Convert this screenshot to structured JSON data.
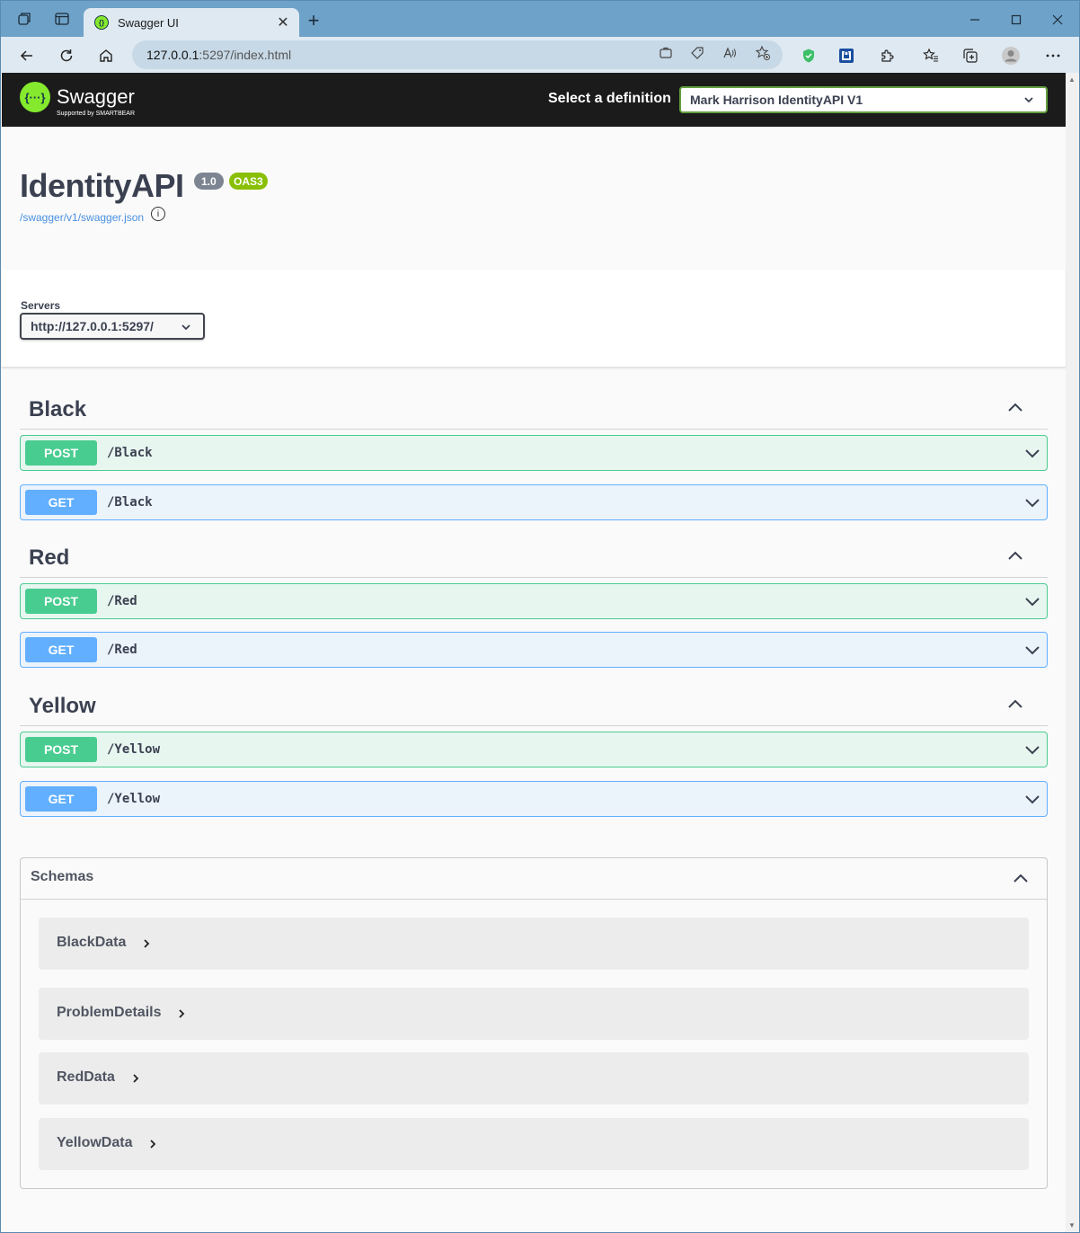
{
  "browser": {
    "tab_title": "Swagger UI",
    "tab_close": "✕",
    "new_tab": "+",
    "url_host": "127.0.0.1",
    "url_rest": ":5297/index.html",
    "icons": [
      "workspaces-icon",
      "tab-actions-icon",
      "back-icon",
      "refresh-icon",
      "home-icon",
      "info-icon",
      "app-available-icon",
      "tag-icon",
      "read-aloud-icon",
      "favorite-add-icon",
      "shield-icon",
      "extension-badge-icon",
      "extensions-icon",
      "favorites-icon",
      "collections-icon",
      "profile-icon",
      "more-icon"
    ]
  },
  "swagger": {
    "logo_text": "Swagger",
    "logo_sub": "Supported by SMARTBEAR",
    "logo_glyph": "{···}",
    "select_label": "Select a definition",
    "selected_definition": "Mark Harrison IdentityAPI V1"
  },
  "info": {
    "title": "IdentityAPI",
    "version": "1.0",
    "oas": "OAS3",
    "spec_link": "/swagger/v1/swagger.json"
  },
  "servers": {
    "label": "Servers",
    "selected": "http://127.0.0.1:5297/"
  },
  "tags": [
    {
      "name": "Black",
      "ops": [
        {
          "method": "POST",
          "path": "/Black"
        },
        {
          "method": "GET",
          "path": "/Black"
        }
      ]
    },
    {
      "name": "Red",
      "ops": [
        {
          "method": "POST",
          "path": "/Red"
        },
        {
          "method": "GET",
          "path": "/Red"
        }
      ]
    },
    {
      "name": "Yellow",
      "ops": [
        {
          "method": "POST",
          "path": "/Yellow"
        },
        {
          "method": "GET",
          "path": "/Yellow"
        }
      ]
    }
  ],
  "schemas": {
    "title": "Schemas",
    "models": [
      "BlackData",
      "ProblemDetails",
      "RedData",
      "YellowData"
    ]
  },
  "colors": {
    "post": "#49cc90",
    "get": "#61affe",
    "topbar": "#1b1b1b",
    "logo": "#85ea2d",
    "oas_badge": "#89bf04",
    "version_badge": "#7d8492"
  }
}
